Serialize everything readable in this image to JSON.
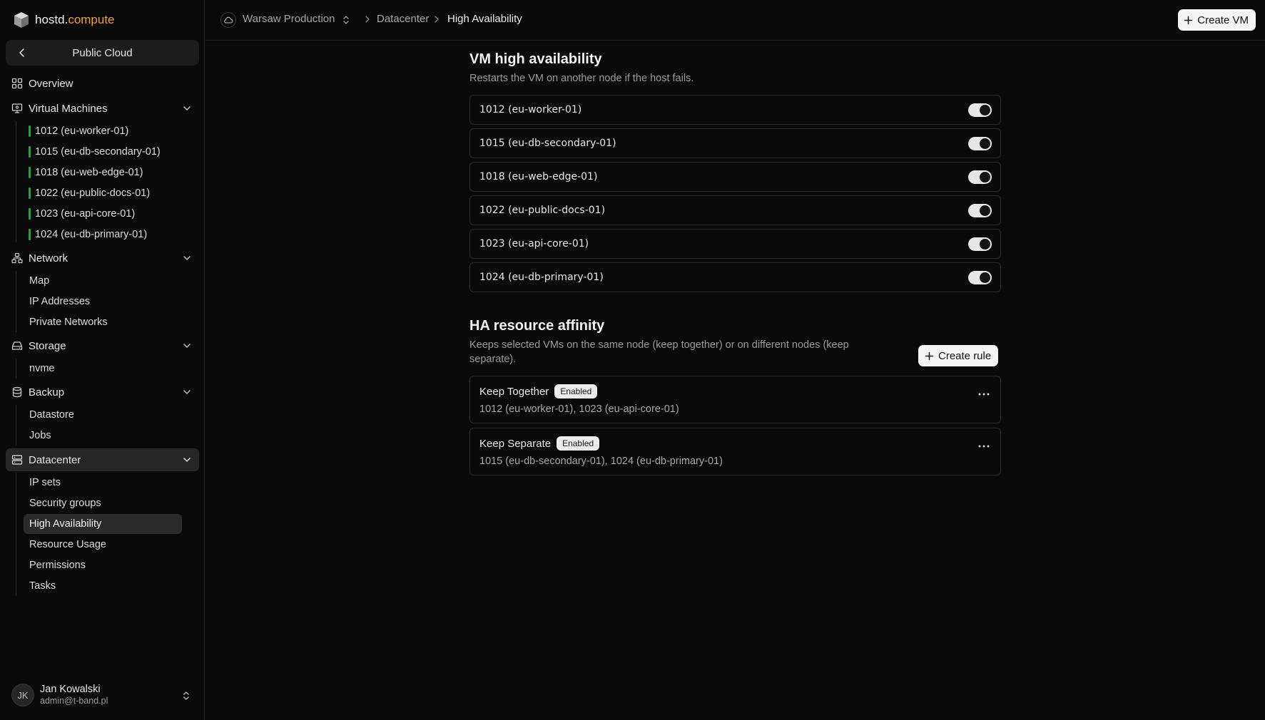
{
  "brand": {
    "name": "hostd.",
    "accent": "compute",
    "accent_color": "#f0a23a"
  },
  "cloud_switch": {
    "label": "Public Cloud"
  },
  "nav": {
    "overview": "Overview",
    "virtual_machines": "Virtual Machines",
    "vms": [
      "1012 (eu-worker-01)",
      "1015 (eu-db-secondary-01)",
      "1018 (eu-web-edge-01)",
      "1022 (eu-public-docs-01)",
      "1023 (eu-api-core-01)",
      "1024 (eu-db-primary-01)"
    ],
    "network": "Network",
    "network_items": [
      "Map",
      "IP Addresses",
      "Private Networks"
    ],
    "storage": "Storage",
    "storage_items": [
      "nvme"
    ],
    "backup": "Backup",
    "backup_items": [
      "Datastore",
      "Jobs"
    ],
    "datacenter": "Datacenter",
    "datacenter_items": [
      "IP sets",
      "Security groups",
      "High Availability",
      "Resource Usage",
      "Permissions",
      "Tasks"
    ],
    "vm_status_color": "#22a34a"
  },
  "user": {
    "initials": "JK",
    "name": "Jan Kowalski",
    "email": "admin@t-band.pl"
  },
  "header": {
    "project": "Warsaw Production",
    "breadcrumb": [
      "Datacenter",
      "High Availability"
    ],
    "create_vm": "Create VM"
  },
  "ha": {
    "title": "VM high availability",
    "description": "Restarts the VM on another node if the host fails.",
    "vms": [
      {
        "label": "1012 (eu-worker-01)",
        "enabled": true
      },
      {
        "label": "1015 (eu-db-secondary-01)",
        "enabled": true
      },
      {
        "label": "1018 (eu-web-edge-01)",
        "enabled": true
      },
      {
        "label": "1022 (eu-public-docs-01)",
        "enabled": true
      },
      {
        "label": "1023 (eu-api-core-01)",
        "enabled": true
      },
      {
        "label": "1024 (eu-db-primary-01)",
        "enabled": true
      }
    ]
  },
  "affinity": {
    "title": "HA resource affinity",
    "description_line1": "Keeps selected VMs on the same node (keep together) or on different nodes (keep",
    "description_line2": "separate).",
    "create_rule": "Create rule",
    "rules": [
      {
        "name": "Keep Together",
        "status": "Enabled",
        "vms": "1012 (eu-worker-01), 1023 (eu-api-core-01)"
      },
      {
        "name": "Keep Separate",
        "status": "Enabled",
        "vms": "1015 (eu-db-secondary-01), 1024 (eu-db-primary-01)"
      }
    ]
  }
}
